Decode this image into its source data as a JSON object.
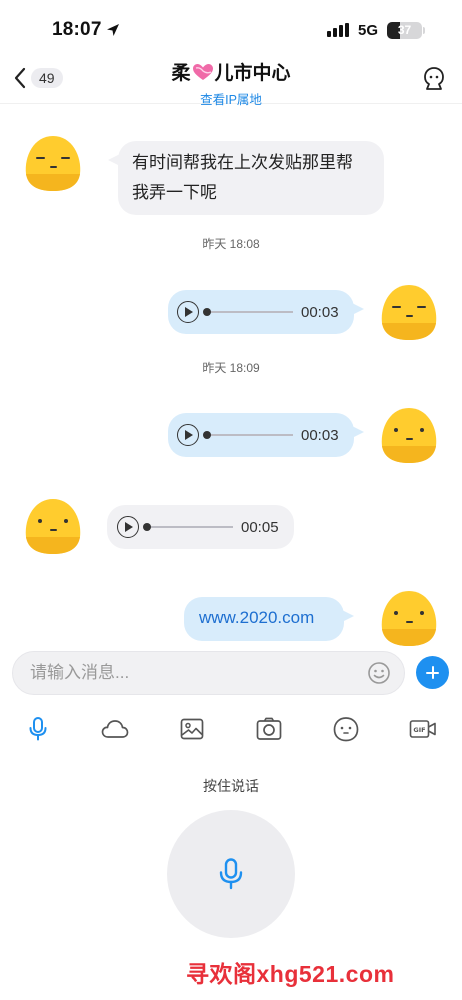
{
  "status_bar": {
    "time": "18:07",
    "network": "5G",
    "battery": "37",
    "battery_level": 0.37
  },
  "header": {
    "back_count": "49",
    "title_part1": "柔",
    "title_part2": "儿市中心",
    "subtitle": "查看IP属地"
  },
  "messages": [
    {
      "side": "left",
      "type": "text",
      "text_line1": "有时间帮我在上次发贴那里帮",
      "text_line2": "我弄一下呢"
    },
    {
      "type": "timestamp",
      "text": "昨天 18:08"
    },
    {
      "side": "right",
      "type": "voice",
      "duration": "00:03"
    },
    {
      "type": "timestamp",
      "text": "昨天 18:09"
    },
    {
      "side": "right",
      "type": "voice",
      "duration": "00:03"
    },
    {
      "side": "left",
      "type": "voice",
      "duration": "00:05"
    },
    {
      "side": "right",
      "type": "link",
      "text": "www.2020.com"
    }
  ],
  "input": {
    "placeholder": "请输入消息..."
  },
  "toolbar": [
    "mic-icon",
    "cloud-icon",
    "image-icon",
    "camera-icon",
    "sticker-icon",
    "gif-icon"
  ],
  "voice_panel": {
    "hold_label": "按住说话"
  },
  "watermark": "寻欢阁xhg521.com",
  "colors": {
    "accent": "#1e90f0",
    "bubble_right": "#d8ecfb",
    "bubble_left": "#f1f1f4",
    "watermark": "#e8303a"
  }
}
